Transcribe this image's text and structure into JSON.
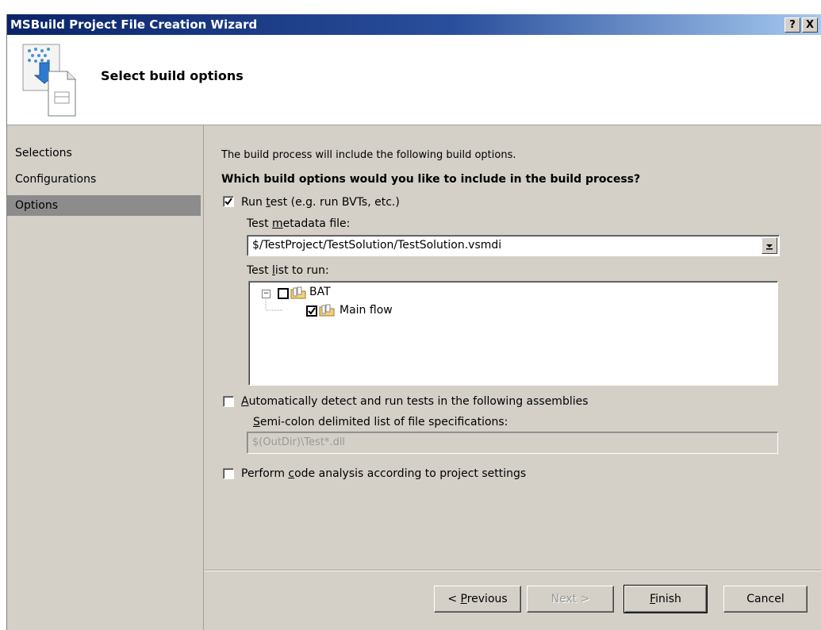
{
  "window": {
    "title": "MSBuild Project File Creation Wizard",
    "help_button": "?",
    "close_button": "X"
  },
  "header": {
    "title": "Select build options"
  },
  "nav": {
    "items": [
      {
        "label": "Selections",
        "selected": false
      },
      {
        "label": "Configurations",
        "selected": false
      },
      {
        "label": "Options",
        "selected": true
      }
    ]
  },
  "content": {
    "intro": "The build process will include the following build options.",
    "question": "Which build options would you like to include in the build process?",
    "run_test": {
      "label_pre": "Run ",
      "label_accel": "t",
      "label_post": "est (e.g. run BVTs, etc.)",
      "checked": true
    },
    "metadata": {
      "label_pre": "Test ",
      "label_accel": "m",
      "label_post": "etadata file:",
      "value": "$/TestProject/TestSolution/TestSolution.vsmdi"
    },
    "test_list": {
      "label_pre": "Test ",
      "label_accel": "l",
      "label_post": "ist to run:",
      "items": [
        {
          "label": "BAT",
          "checked": false,
          "expanded": true,
          "expander": "−"
        },
        {
          "label": "Main flow",
          "checked": true
        }
      ]
    },
    "auto_detect": {
      "label_accel": "A",
      "label_post": "utomatically detect and run tests in the following assemblies",
      "checked": false
    },
    "file_spec": {
      "label_accel": "S",
      "label_post": "emi-colon delimited list of file specifications:",
      "value": "$(OutDir)\\Test*.dll"
    },
    "code_analysis": {
      "label_pre": "Perform ",
      "label_accel": "c",
      "label_post": "ode analysis according to project settings",
      "checked": false
    }
  },
  "buttons": {
    "previous_pre": "< ",
    "previous_accel": "P",
    "previous_post": "revious",
    "next": "Next >",
    "finish_accel": "F",
    "finish_post": "inish",
    "cancel": "Cancel"
  },
  "colors": {
    "title_bar_start": "#0a246a",
    "title_bar_end": "#a6caf0",
    "dialog_face": "#d4d0c8",
    "nav_selected": "#8c8c8c"
  }
}
